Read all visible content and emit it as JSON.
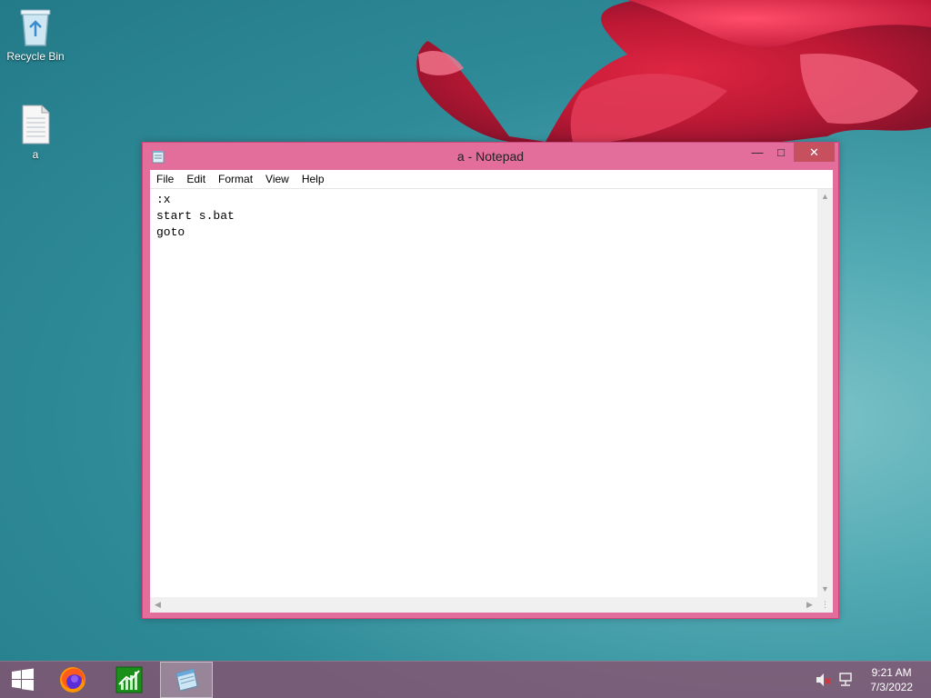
{
  "desktop": {
    "icons": [
      {
        "label": "Recycle Bin",
        "icon": "recycle-bin-icon"
      },
      {
        "label": "a",
        "icon": "text-file-icon"
      }
    ]
  },
  "window": {
    "title": "a - Notepad",
    "app_icon": "notepad-icon",
    "controls": {
      "minimize": "minimize",
      "maximize": "maximize",
      "close": "close"
    },
    "accent_color": "#e36d9b",
    "menu": [
      "File",
      "Edit",
      "Format",
      "View",
      "Help"
    ],
    "content_lines": [
      ":x",
      "start s.bat",
      "goto"
    ]
  },
  "taskbar": {
    "apps": [
      {
        "name": "Start",
        "icon": "windows-start-icon"
      },
      {
        "name": "Firefox",
        "icon": "firefox-icon"
      },
      {
        "name": "Task Manager",
        "icon": "task-manager-icon"
      },
      {
        "name": "Notepad",
        "icon": "notepad-icon",
        "active": true
      }
    ],
    "tray": {
      "icons": [
        "volume-muted-icon",
        "network-icon"
      ],
      "time": "9:21 AM",
      "date": "7/3/2022"
    }
  }
}
